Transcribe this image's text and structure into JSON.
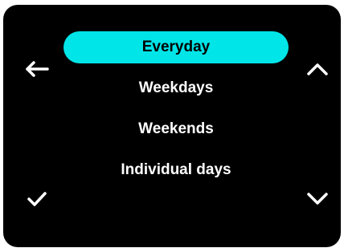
{
  "menu": {
    "items": [
      {
        "label": "Everyday",
        "selected": true
      },
      {
        "label": "Weekdays",
        "selected": false
      },
      {
        "label": "Weekends",
        "selected": false
      },
      {
        "label": "Individual days",
        "selected": false
      }
    ]
  },
  "icons": {
    "back": "arrow-left-icon",
    "up": "chevron-up-icon",
    "confirm": "checkmark-icon",
    "down": "chevron-down-icon"
  },
  "colors": {
    "background": "#000000",
    "accent": "#00e5e8",
    "text": "#ffffff",
    "selected_text": "#000000"
  }
}
